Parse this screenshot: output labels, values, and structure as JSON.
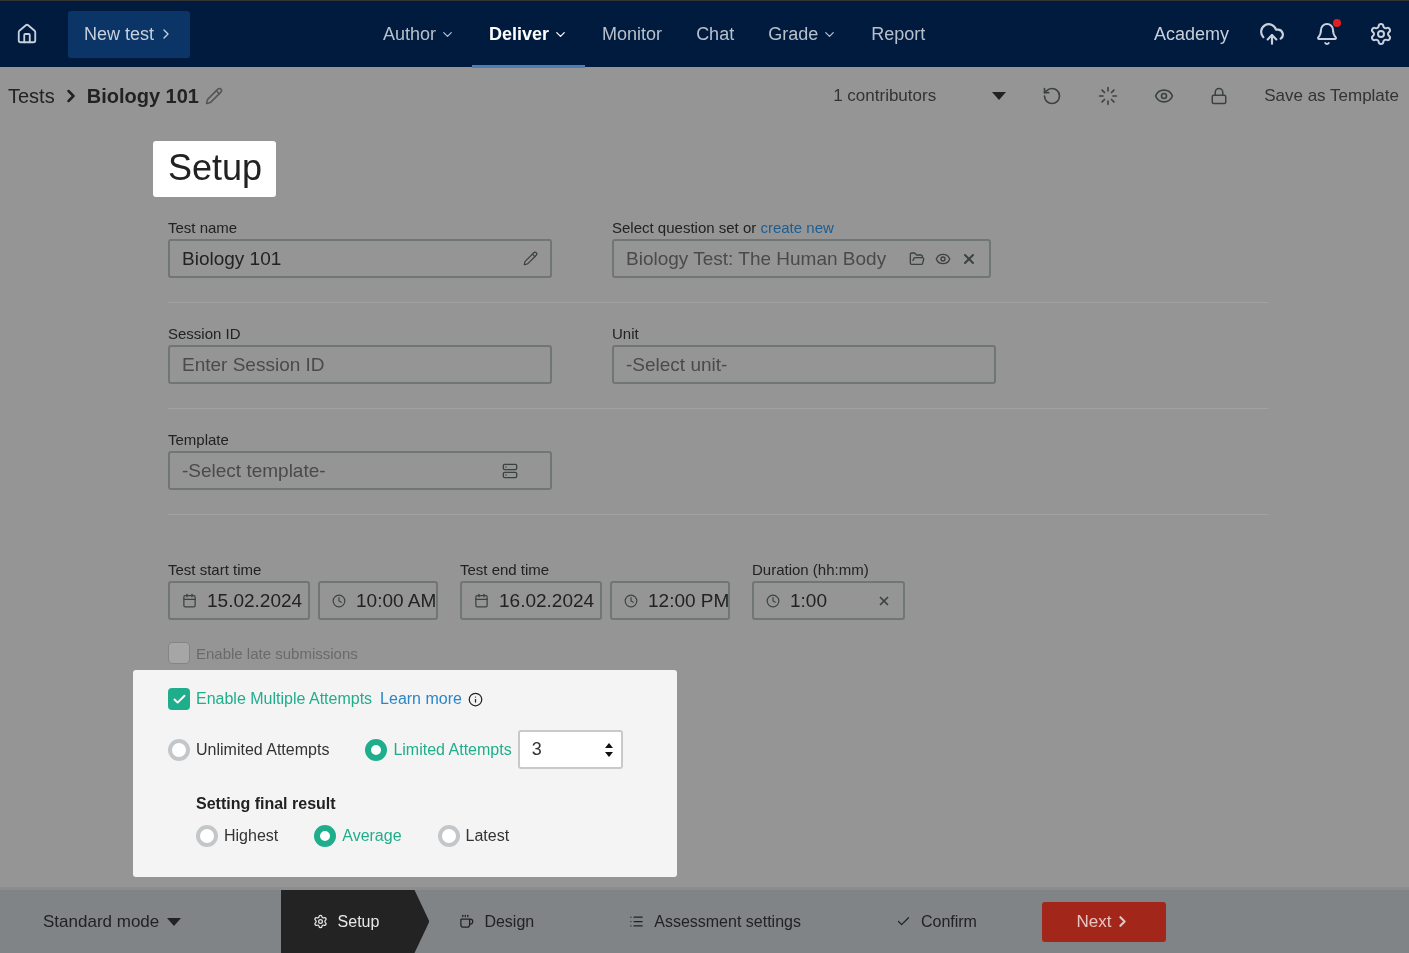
{
  "nav": {
    "new_test": "New test",
    "menu": [
      {
        "label": "Author",
        "dropdown": true,
        "selected": false
      },
      {
        "label": "Deliver",
        "dropdown": true,
        "selected": true
      },
      {
        "label": "Monitor",
        "dropdown": false,
        "selected": false
      },
      {
        "label": "Chat",
        "dropdown": false,
        "selected": false
      },
      {
        "label": "Grade",
        "dropdown": true,
        "selected": false
      },
      {
        "label": "Report",
        "dropdown": false,
        "selected": false
      }
    ],
    "academy": "Academy",
    "has_notification": true
  },
  "breadcrumb": {
    "root": "Tests",
    "current": "Biology 101",
    "contributors": "1 contributors",
    "save_template": "Save as Template"
  },
  "page_title": "Setup",
  "test_name": {
    "label": "Test name",
    "value": "Biology 101"
  },
  "question_set": {
    "label": "Select question set or",
    "link": "create new",
    "value": "Biology Test: The Human Body"
  },
  "session_id": {
    "label": "Session ID",
    "placeholder": "Enter Session ID"
  },
  "unit": {
    "label": "Unit",
    "value": "-Select unit-"
  },
  "template": {
    "label": "Template",
    "value": "-Select template-"
  },
  "start": {
    "label": "Test start time",
    "date": "15.02.2024",
    "time": "10:00 AM"
  },
  "end": {
    "label": "Test end time",
    "date": "16.02.2024",
    "time": "12:00 PM"
  },
  "duration": {
    "label": "Duration (hh:mm)",
    "value": "1:00"
  },
  "late_submissions": {
    "label": "Enable late submissions",
    "checked": false,
    "disabled": true
  },
  "multiple_attempts": {
    "label": "Enable Multiple Attempts",
    "checked": true,
    "link": "Learn more",
    "modes": [
      {
        "label": "Unlimited Attempts",
        "selected": false
      },
      {
        "label": "Limited Attempts",
        "selected": true
      }
    ],
    "attempts": "3",
    "final_title": "Setting final result",
    "final_options": [
      {
        "label": "Highest",
        "selected": false
      },
      {
        "label": "Average",
        "selected": true
      },
      {
        "label": "Latest",
        "selected": false
      }
    ]
  },
  "footer": {
    "mode": "Standard mode",
    "steps": [
      {
        "label": "Setup",
        "selected": true
      },
      {
        "label": "Design",
        "selected": false
      },
      {
        "label": "Assessment settings",
        "selected": false
      },
      {
        "label": "Confirm",
        "selected": false
      }
    ],
    "next": "Next"
  }
}
